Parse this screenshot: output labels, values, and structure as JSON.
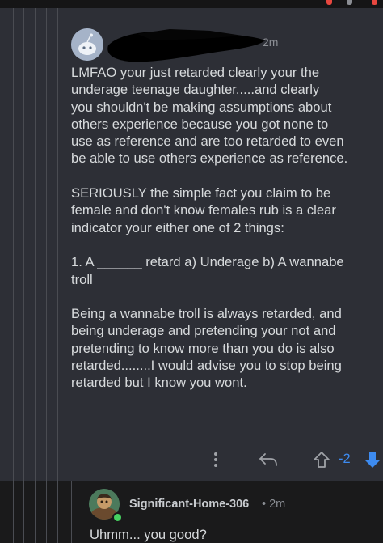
{
  "colors": {
    "background": "#1a1a1b",
    "comment_card": "#2d2f36",
    "text": "#d7dadc",
    "muted": "#8b8e94",
    "upvote_accent": "#3d8bf0",
    "top_icon_accent": "#e8473f"
  },
  "parent_comment": {
    "username": "[redacted]",
    "timestamp": "2m",
    "paragraphs": [
      [
        "LMFAO your just retarded clearly your the",
        "underage teenage daughter.....and clearly",
        "you shouldn't be making assumptions about",
        "others experience because you got none to",
        "use as reference and are too retarded to even",
        "be able to use others experience as reference."
      ],
      [
        "SERIOUSLY the simple fact you claim to be",
        "female and don't know females rub is a clear",
        "indicator your either one of 2 things:"
      ],
      [
        "1. A ______ retard a) Underage b) A wannabe",
        "troll"
      ],
      [
        "Being a wannabe troll is always retarded, and",
        "being underage and pretending your not and",
        "pretending to know more than you do is also",
        "retarded........I would advise you to stop being",
        "retarded but I know you wont."
      ]
    ],
    "actions": {
      "more_icon": "more-vertical-icon",
      "reply_icon": "reply-arrow-icon",
      "upvote_icon": "upvote-arrow-icon",
      "score": "-2",
      "downvote_icon": "downvote-arrow-icon"
    }
  },
  "reply_comment": {
    "username": "Significant-Home-306",
    "separator": "•",
    "timestamp": "2m",
    "text": "Uhmm... you good?",
    "online_status": "online"
  }
}
